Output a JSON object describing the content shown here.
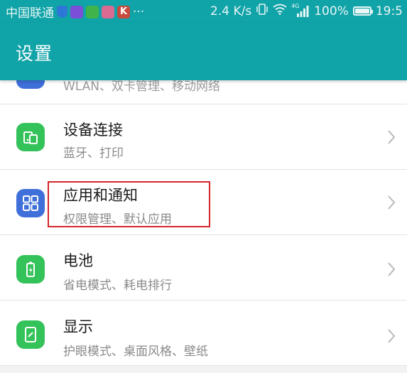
{
  "status_bar": {
    "carrier": "中国联通",
    "dots": "···",
    "speed": "2.4 K/s",
    "network_label": "4G",
    "battery": "100%",
    "time": "19:5"
  },
  "header": {
    "title": "设置"
  },
  "settings": [
    {
      "title": "",
      "subtitle": "WLAN、双卡管理、移动网络"
    },
    {
      "title": "设备连接",
      "subtitle": "蓝牙、打印"
    },
    {
      "title": "应用和通知",
      "subtitle": "权限管理、默认应用"
    },
    {
      "title": "电池",
      "subtitle": "省电模式、耗电排行"
    },
    {
      "title": "显示",
      "subtitle": "护眼模式、桌面风格、壁纸"
    }
  ],
  "colors": {
    "accent": "#10a3a8",
    "icon_green": "#34c25a",
    "icon_blue": "#3f6fd9",
    "highlight_border": "#d4262c"
  }
}
